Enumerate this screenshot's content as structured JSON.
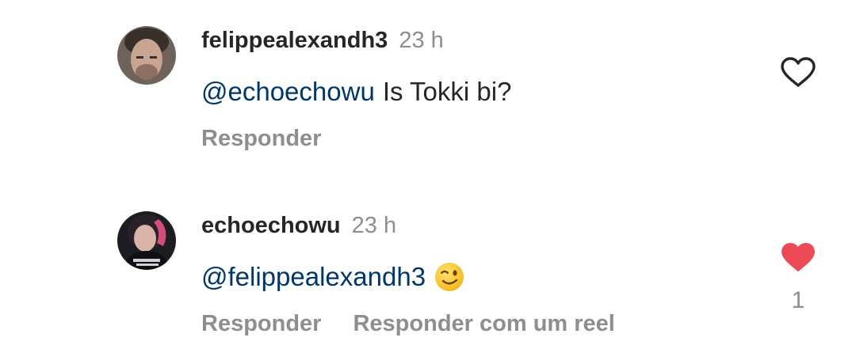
{
  "comments": [
    {
      "username": "felippealexandh3",
      "time": "23 h",
      "mention": "@echoechowu",
      "text": "Is Tokki bi?",
      "emoji": "",
      "actions": [
        "Responder"
      ],
      "liked": false,
      "like_count": ""
    },
    {
      "username": "echoechowu",
      "time": "23 h",
      "mention": "@felippealexandh3",
      "text": "",
      "emoji": "winking-face",
      "actions": [
        "Responder",
        "Responder com um reel"
      ],
      "liked": true,
      "like_count": "1"
    }
  ],
  "colors": {
    "text": "#262626",
    "secondary": "#8e8e8e",
    "mention": "#00376b",
    "like_active": "#ed4956"
  },
  "icons": {
    "like_empty": "heart-outline-icon",
    "like_filled": "heart-filled-icon"
  }
}
